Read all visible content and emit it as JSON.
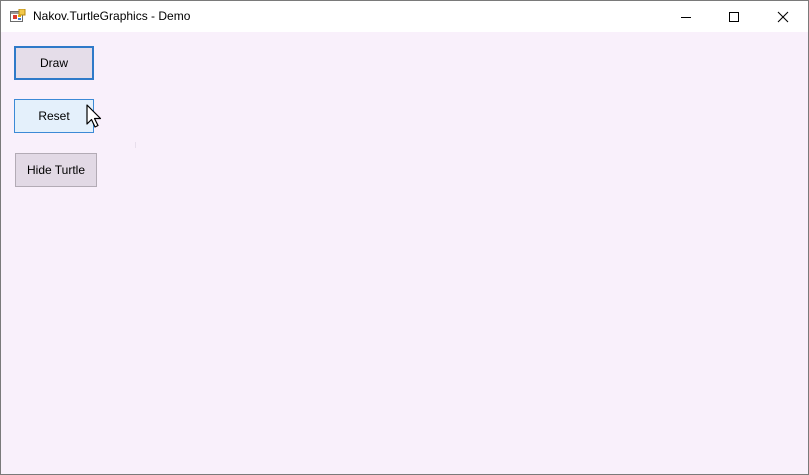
{
  "window": {
    "title": "Nakov.TurtleGraphics - Demo",
    "app_icon": "winforms-app-icon",
    "controls": {
      "minimize_icon": "minimize-icon",
      "maximize_icon": "maximize-icon",
      "close_icon": "close-icon"
    }
  },
  "form": {
    "background": "#f9f0fb",
    "buttons": {
      "draw_label": "Draw",
      "reset_label": "Reset",
      "hide_turtle_label": "Hide Turtle"
    }
  },
  "colors": {
    "focus_border": "#2f7ac9",
    "hover_fill": "#e4f0fb",
    "button_fill": "#e2d9e5"
  }
}
